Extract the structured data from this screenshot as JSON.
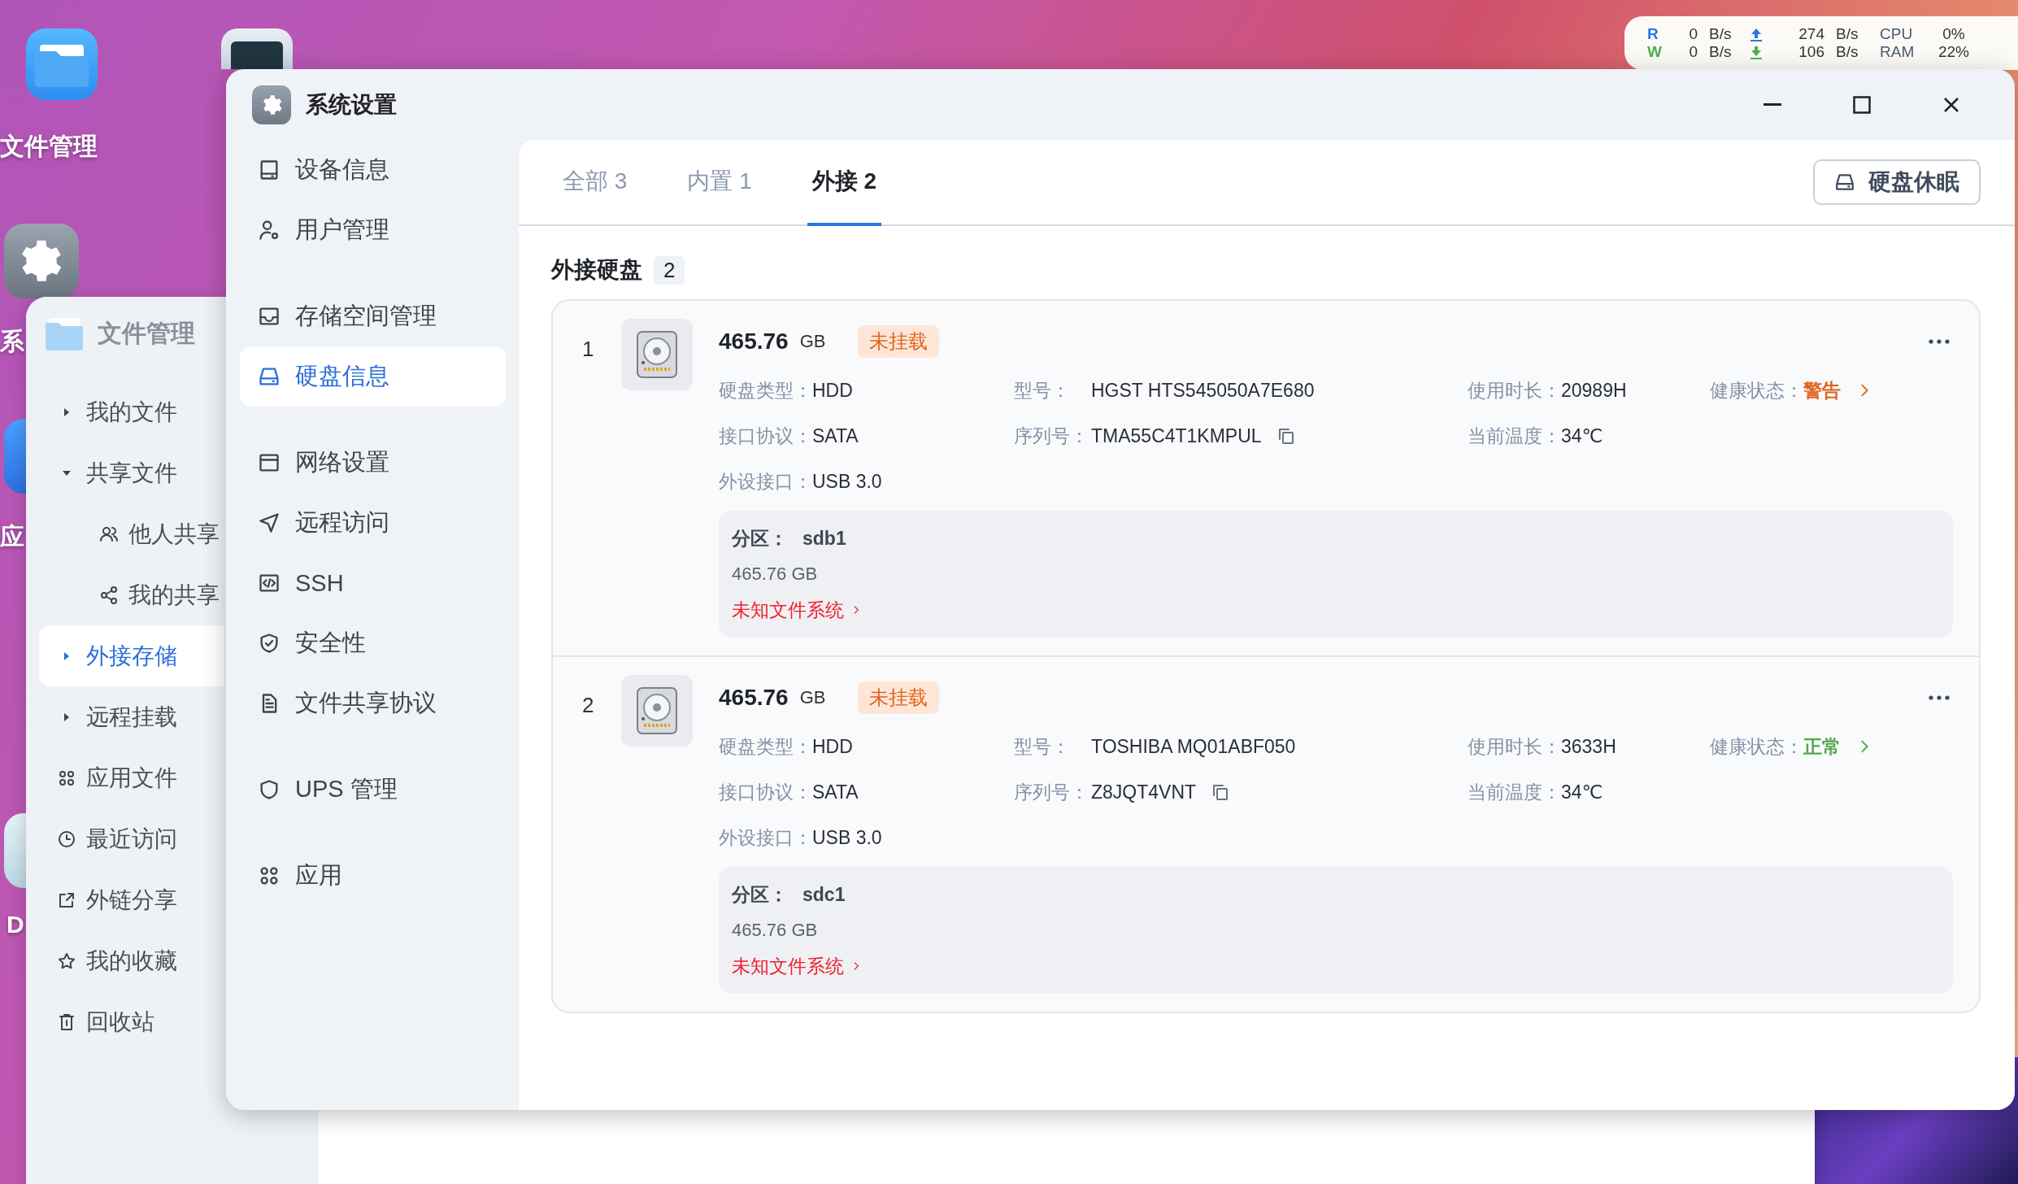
{
  "desktop": {
    "icons": [
      {
        "label": "文件管理",
        "kind": "folder"
      },
      {
        "kind": "monitor"
      },
      {
        "label": "系",
        "kind": "settings"
      },
      {
        "label": "应",
        "kind": "app"
      },
      {
        "label": "D",
        "kind": "doc"
      }
    ]
  },
  "monitor_widget": {
    "rows": [
      {
        "kind": "read",
        "label": "R",
        "disk": "0",
        "disk_unit": "B/s",
        "net": "274",
        "net_unit": "B/s",
        "metric": "CPU",
        "percent": "0%"
      },
      {
        "kind": "write",
        "label": "W",
        "disk": "0",
        "disk_unit": "B/s",
        "net": "106",
        "net_unit": "B/s",
        "metric": "RAM",
        "percent": "22%"
      }
    ]
  },
  "file_manager": {
    "title": "文件管理",
    "nav": [
      {
        "kind": "group",
        "label": "我的文件",
        "expanded": false,
        "selected": false
      },
      {
        "kind": "group",
        "label": "共享文件",
        "expanded": true,
        "selected": false,
        "children": [
          {
            "label": "他人共享",
            "selected": false
          },
          {
            "label": "我的共享",
            "selected": false
          }
        ]
      },
      {
        "kind": "group",
        "label": "外接存储",
        "expanded": false,
        "selected": true
      },
      {
        "kind": "group",
        "label": "远程挂载",
        "expanded": false,
        "selected": false
      },
      {
        "kind": "link",
        "label": "应用文件",
        "selected": false
      },
      {
        "kind": "link",
        "label": "最近访问",
        "selected": false
      },
      {
        "kind": "link",
        "label": "外链分享",
        "selected": false
      },
      {
        "kind": "link",
        "label": "我的收藏",
        "selected": false
      },
      {
        "kind": "link",
        "label": "回收站",
        "selected": false
      }
    ]
  },
  "settings_window": {
    "title": "系统设置",
    "sidebar": {
      "groups": [
        {
          "items": [
            {
              "label": "设备信息",
              "selected": false
            },
            {
              "label": "用户管理",
              "selected": false
            }
          ]
        },
        {
          "items": [
            {
              "label": "存储空间管理",
              "selected": false
            },
            {
              "label": "硬盘信息",
              "selected": true
            }
          ]
        },
        {
          "items": [
            {
              "label": "网络设置",
              "selected": false
            },
            {
              "label": "远程访问",
              "selected": false
            },
            {
              "label": "SSH",
              "selected": false
            },
            {
              "label": "安全性",
              "selected": false
            },
            {
              "label": "文件共享协议",
              "selected": false
            }
          ]
        },
        {
          "items": [
            {
              "label": "UPS 管理",
              "selected": false
            }
          ]
        },
        {
          "items": [
            {
              "label": "应用",
              "selected": false
            }
          ]
        }
      ]
    },
    "tabs": [
      {
        "label": "全部 3",
        "selected": false
      },
      {
        "label": "内置 1",
        "selected": false
      },
      {
        "label": "外接 2",
        "selected": true
      }
    ],
    "sleep_button": "硬盘休眠",
    "section": {
      "title": "外接硬盘",
      "count": "2"
    },
    "disks": [
      {
        "index": "1",
        "size": "465.76",
        "unit": "GB",
        "status": "未挂载",
        "columns": [
          {
            "fields": [
              {
                "kind": "plain",
                "label": "硬盘类型：",
                "value": "HDD"
              },
              {
                "kind": "plain",
                "label": "接口协议：",
                "value": "SATA"
              },
              {
                "kind": "plain",
                "label": "外设接口：",
                "value": "USB 3.0"
              }
            ]
          },
          {
            "fields": [
              {
                "kind": "plain",
                "label": "型号：",
                "value": "HGST HTS545050A7E680"
              },
              {
                "kind": "copyable",
                "label": "序列号：",
                "value": "TMA55C4T1KMPUL"
              }
            ]
          },
          {
            "fields": [
              {
                "kind": "plain",
                "label": "使用时长：",
                "value": "20989H"
              },
              {
                "kind": "plain",
                "label": "当前温度：",
                "value": "34℃"
              }
            ]
          },
          {
            "fields": [
              {
                "kind": "health",
                "label": "健康状态：",
                "value": "警告",
                "color": "#e0641c"
              }
            ]
          }
        ],
        "partition": {
          "label": "分区：",
          "name": "sdb1",
          "size": "465.76 GB",
          "filesystem": "未知文件系统"
        }
      },
      {
        "index": "2",
        "size": "465.76",
        "unit": "GB",
        "status": "未挂载",
        "columns": [
          {
            "fields": [
              {
                "kind": "plain",
                "label": "硬盘类型：",
                "value": "HDD"
              },
              {
                "kind": "plain",
                "label": "接口协议：",
                "value": "SATA"
              },
              {
                "kind": "plain",
                "label": "外设接口：",
                "value": "USB 3.0"
              }
            ]
          },
          {
            "fields": [
              {
                "kind": "plain",
                "label": "型号：",
                "value": "TOSHIBA MQ01ABF050"
              },
              {
                "kind": "copyable",
                "label": "序列号：",
                "value": "Z8JQT4VNT"
              }
            ]
          },
          {
            "fields": [
              {
                "kind": "plain",
                "label": "使用时长：",
                "value": "3633H"
              },
              {
                "kind": "plain",
                "label": "当前温度：",
                "value": "34℃"
              }
            ]
          },
          {
            "fields": [
              {
                "kind": "health",
                "label": "健康状态：",
                "value": "正常",
                "color": "#52a84a"
              }
            ]
          }
        ],
        "partition": {
          "label": "分区：",
          "name": "sdc1",
          "size": "465.76 GB",
          "filesystem": "未知文件系统"
        }
      }
    ]
  }
}
